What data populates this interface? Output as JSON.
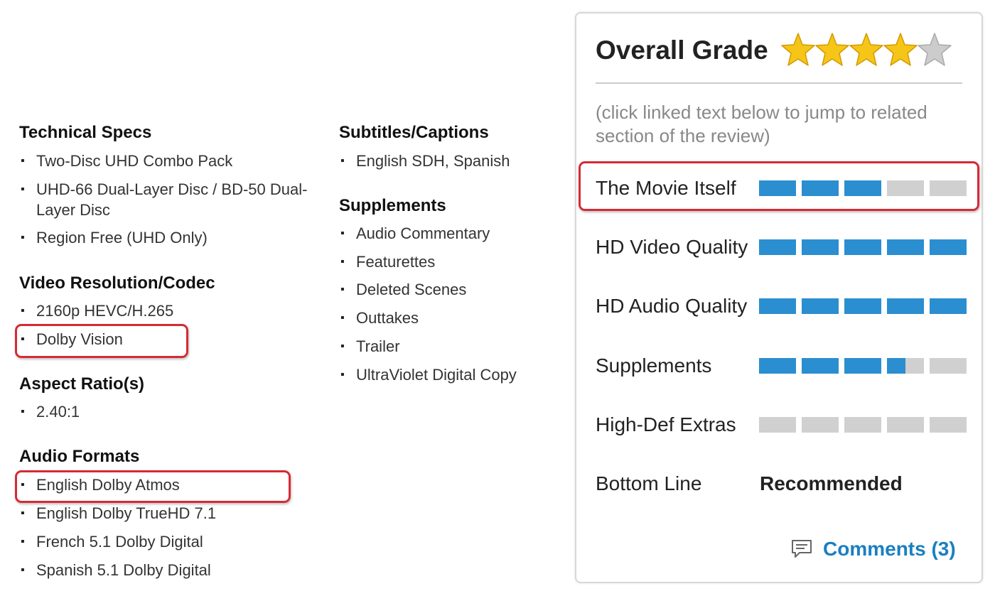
{
  "left_column": {
    "sections": [
      {
        "title": "Technical Specs",
        "items": [
          "Two-Disc UHD Combo Pack",
          "UHD-66 Dual-Layer Disc / BD-50 Dual-Layer Disc",
          "Region Free (UHD Only)"
        ]
      },
      {
        "title": "Video Resolution/Codec",
        "items": [
          "2160p HEVC/H.265",
          "Dolby Vision"
        ]
      },
      {
        "title": "Aspect Ratio(s)",
        "items": [
          "2.40:1"
        ]
      },
      {
        "title": "Audio Formats",
        "items": [
          "English Dolby Atmos",
          "English Dolby TrueHD 7.1",
          "French 5.1 Dolby Digital",
          "Spanish 5.1 Dolby Digital"
        ]
      }
    ]
  },
  "middle_column": {
    "sections": [
      {
        "title": "Subtitles/Captions",
        "items": [
          "English SDH, Spanish"
        ]
      },
      {
        "title": "Supplements",
        "items": [
          "Audio Commentary",
          "Featurettes",
          "Deleted Scenes",
          "Outtakes",
          "Trailer",
          "UltraViolet Digital Copy"
        ]
      }
    ]
  },
  "grade_panel": {
    "title": "Overall Grade",
    "stars": {
      "value": 4,
      "max": 5
    },
    "hint": "(click linked text below to jump to related section of the review)",
    "ratings": [
      {
        "label": "The Movie Itself",
        "value": 3,
        "max": 5
      },
      {
        "label": "HD Video Quality",
        "value": 5,
        "max": 5
      },
      {
        "label": "HD Audio Quality",
        "value": 5,
        "max": 5
      },
      {
        "label": "Supplements",
        "value": 3.5,
        "max": 5
      },
      {
        "label": "High-Def Extras",
        "value": 0,
        "max": 5
      }
    ],
    "bottom_line": {
      "label": "Bottom Line",
      "value": "Recommended"
    },
    "comments_label": "Comments (3)"
  },
  "colors": {
    "highlight_border": "#d62a35",
    "bar_fill": "#2b8ed0",
    "bar_empty": "#d0d0d0",
    "link": "#1a7fc1",
    "star_gold": "#f5c518",
    "star_gray": "#cccccc"
  },
  "icons": {
    "comments": "speech-bubble-icon",
    "rating": "star-icon"
  }
}
